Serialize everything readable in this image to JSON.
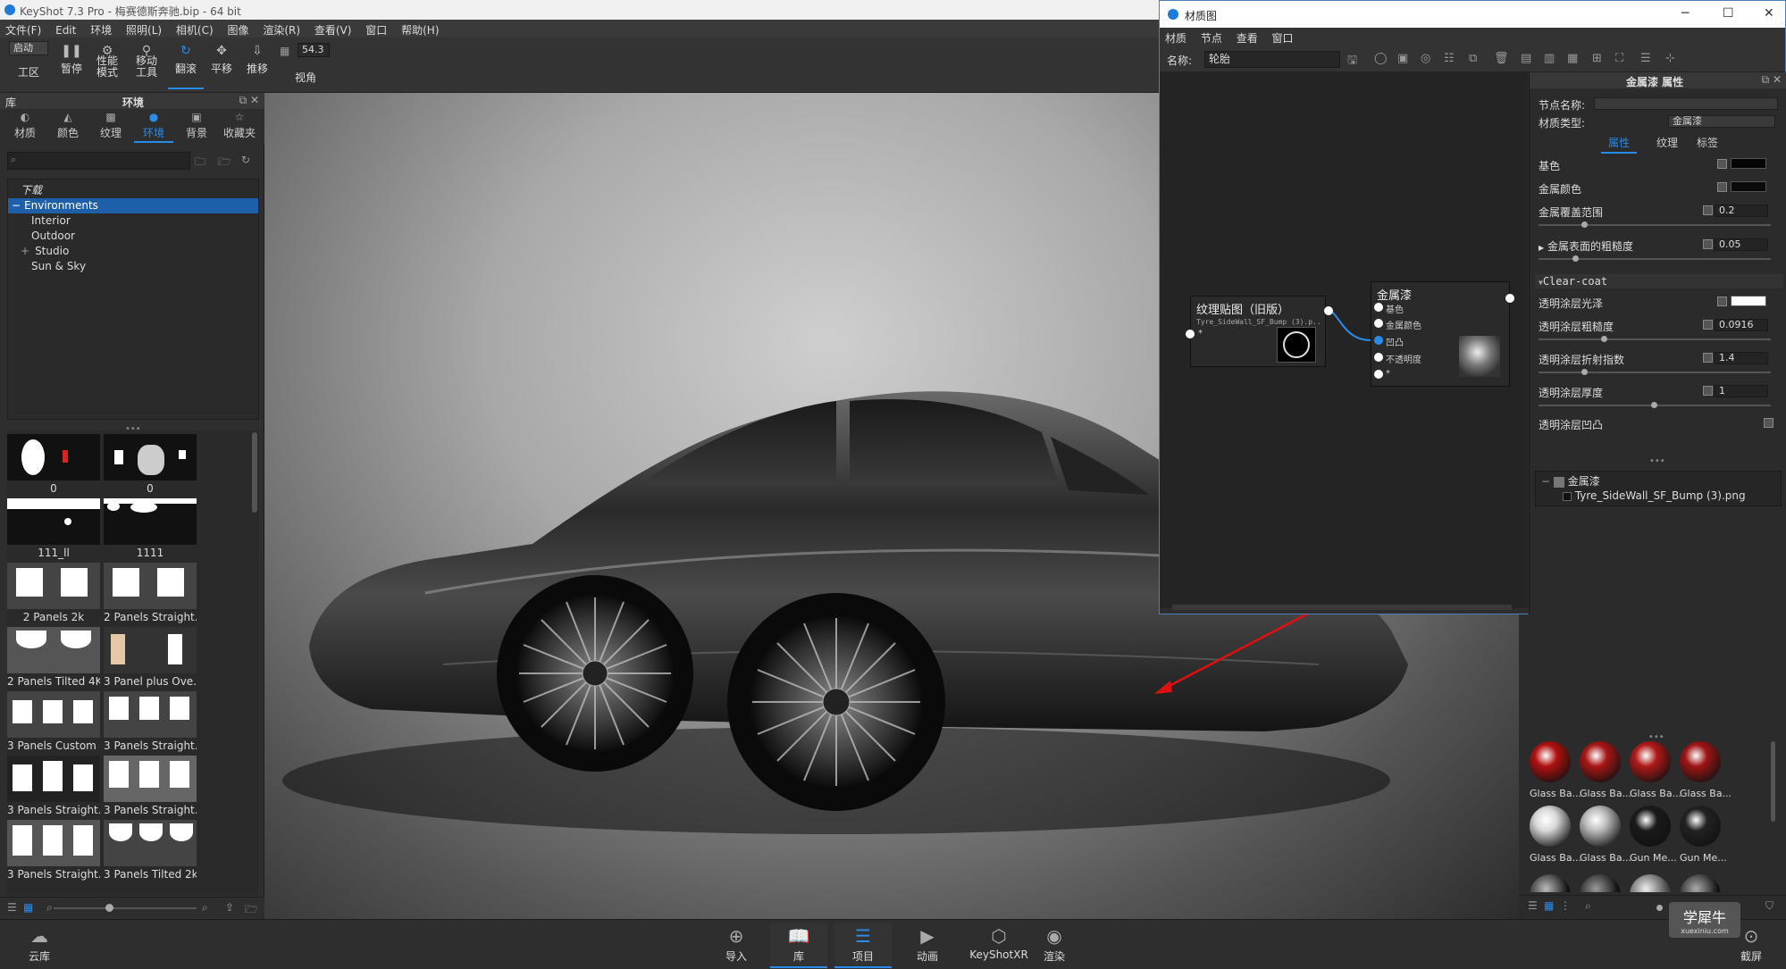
{
  "titlebar": {
    "title": "KeyShot 7.3 Pro - 梅赛德斯奔驰.bip - 64 bit"
  },
  "menu": [
    "文件(F)",
    "Edit",
    "环境",
    "照明(L)",
    "相机(C)",
    "图像",
    "渲染(R)",
    "查看(V)",
    "窗口",
    "帮助(H)"
  ],
  "toolbar": {
    "start_dropdown": "启动",
    "workspace": "工区",
    "pause": "暂停",
    "perf_line1": "性能",
    "perf_line2": "模式",
    "move_line1": "移动",
    "move_line2": "工具",
    "tumble": "翻滚",
    "pan": "平移",
    "dolly": "推移",
    "fov_value": "54.3",
    "fov": "视角"
  },
  "library": {
    "header_left": "库",
    "header_center": "环境",
    "tabs": [
      "材质",
      "颜色",
      "纹理",
      "环境",
      "背景",
      "收藏夹"
    ],
    "active_tab": "环境",
    "tree": [
      {
        "label": "下载",
        "indent": 0,
        "italic": true
      },
      {
        "label": "Environments",
        "indent": 0,
        "selected": true,
        "prefix": "−"
      },
      {
        "label": "Interior",
        "indent": 1
      },
      {
        "label": "Outdoor",
        "indent": 1
      },
      {
        "label": "Studio",
        "indent": 1,
        "prefix": "+"
      },
      {
        "label": "Sun & Sky",
        "indent": 1
      }
    ],
    "thumbs": [
      "0",
      "0",
      "111_ll",
      "1111",
      "2 Panels 2k",
      "2 Panels Straight...",
      "2 Panels Tilted 4K",
      "3 Panel plus Ove...",
      "3 Panels Custom ...",
      "3 Panels Straight...",
      "3 Panels Straight...",
      "3 Panels Straight...",
      "3 Panels Straight...",
      "3 Panels Tilted 2k"
    ]
  },
  "material_window": {
    "title": "材质图",
    "menu": [
      "材质",
      "节点",
      "查看",
      "窗口"
    ],
    "name_label": "名称:",
    "name_value": "轮胎",
    "texture_node": {
      "title": "纹理贴图（旧版）",
      "file": "Tyre_SideWall_SF_Bump (3).p..."
    },
    "metal_node": {
      "title": "金属漆",
      "ports": [
        "基色",
        "金属颜色",
        "凹凸",
        "不透明度",
        "*"
      ]
    },
    "properties": {
      "header": "金属漆 属性",
      "node_name_label": "节点名称:",
      "material_type_label": "材质类型:",
      "material_type_value": "金属漆",
      "tabs": [
        "属性",
        "纹理",
        "标签"
      ],
      "base_color": "基色",
      "metal_color": "金属颜色",
      "metal_coverage": "金属覆盖范围",
      "metal_coverage_value": "0.2",
      "metal_roughness": "金属表面的粗糙度",
      "metal_roughness_value": "0.05",
      "section_clearcoat": "Clear-coat",
      "clearcoat_gloss": "透明涂层光泽",
      "clearcoat_roughness": "透明涂层粗糙度",
      "clearcoat_roughness_value": "0.0916",
      "clearcoat_ior": "透明涂层折射指数",
      "clearcoat_ior_value": "1.4",
      "clearcoat_thickness": "透明涂层厚度",
      "clearcoat_thickness_value": "1",
      "clearcoat_bump": "透明涂层凹凸",
      "tree_root": "金属漆",
      "tree_child": "Tyre_SideWall_SF_Bump (3).png"
    }
  },
  "material_library": {
    "balls": [
      {
        "label": "Glass Ba...",
        "color": "#b01010"
      },
      {
        "label": "Glass Ba...",
        "color": "#a81515"
      },
      {
        "label": "Glass Ba...",
        "color": "#b01818"
      },
      {
        "label": "Glass Ba...",
        "color": "#9e1414"
      },
      {
        "label": "Glass Ba...",
        "color": "#d8d8d8"
      },
      {
        "label": "Glass Ba...",
        "color": "#bcbcbc"
      },
      {
        "label": "Gun Me...",
        "color": "#1a1a1a"
      },
      {
        "label": "Gun Me...",
        "color": "#222222"
      }
    ]
  },
  "bottombar": {
    "cloud": "云库",
    "import": "导入",
    "library": "库",
    "project": "项目",
    "animation": "动画",
    "keyshotxr": "KeyShotXR",
    "render": "渲染",
    "screenshot": "截屏"
  },
  "watermark": {
    "main": "学犀牛",
    "sub": "xuexiniu.com"
  },
  "colors": {
    "accent": "#2a8be8",
    "selection": "#1d5fa8",
    "annotation_arrow": "#e01010"
  }
}
